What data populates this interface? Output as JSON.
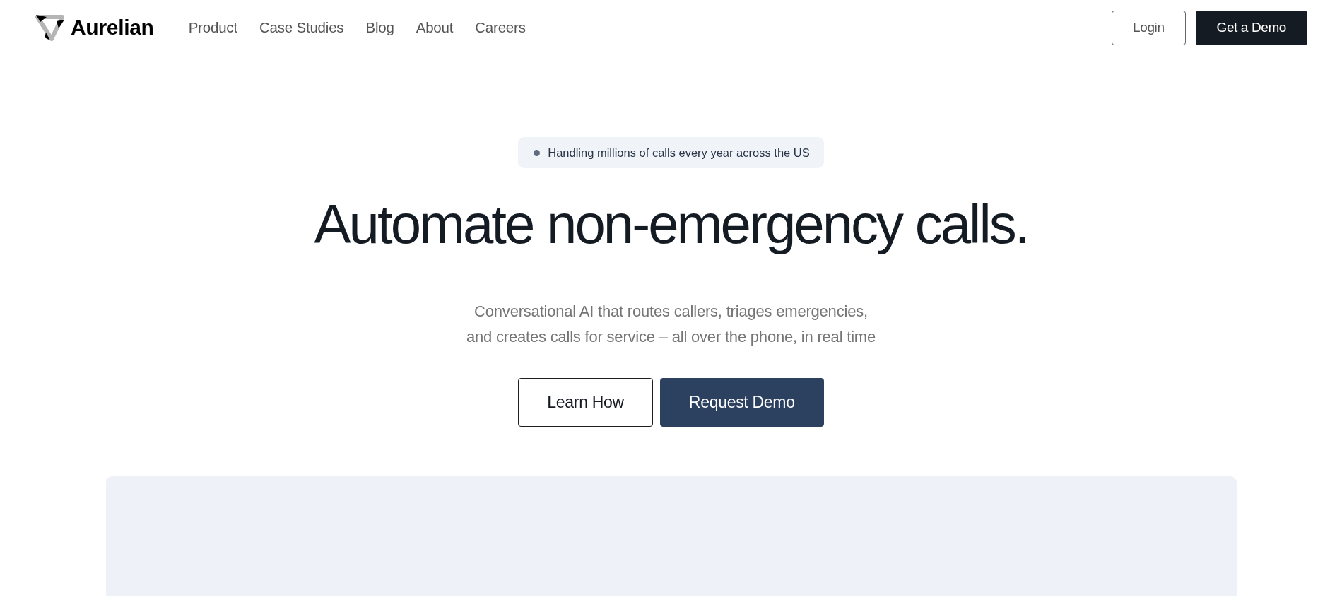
{
  "navbar": {
    "brand": "Aurelian",
    "links": [
      "Product",
      "Case Studies",
      "Blog",
      "About",
      "Careers"
    ],
    "buttons": [
      {
        "label": "Login",
        "kind": "outline"
      },
      {
        "label": "Get a Demo",
        "kind": "solid"
      }
    ]
  },
  "hero": {
    "badge": "Handling millions of calls every year across the US",
    "title": "Automate non-emergency calls.",
    "subtitle_lines": [
      "Conversational AI that routes callers, triages emergencies,",
      "and creates calls for service – all over the phone, in real time"
    ],
    "buttons": [
      {
        "label": "Learn How",
        "kind": "outline"
      },
      {
        "label": "Request Demo",
        "kind": "solid"
      }
    ]
  }
}
